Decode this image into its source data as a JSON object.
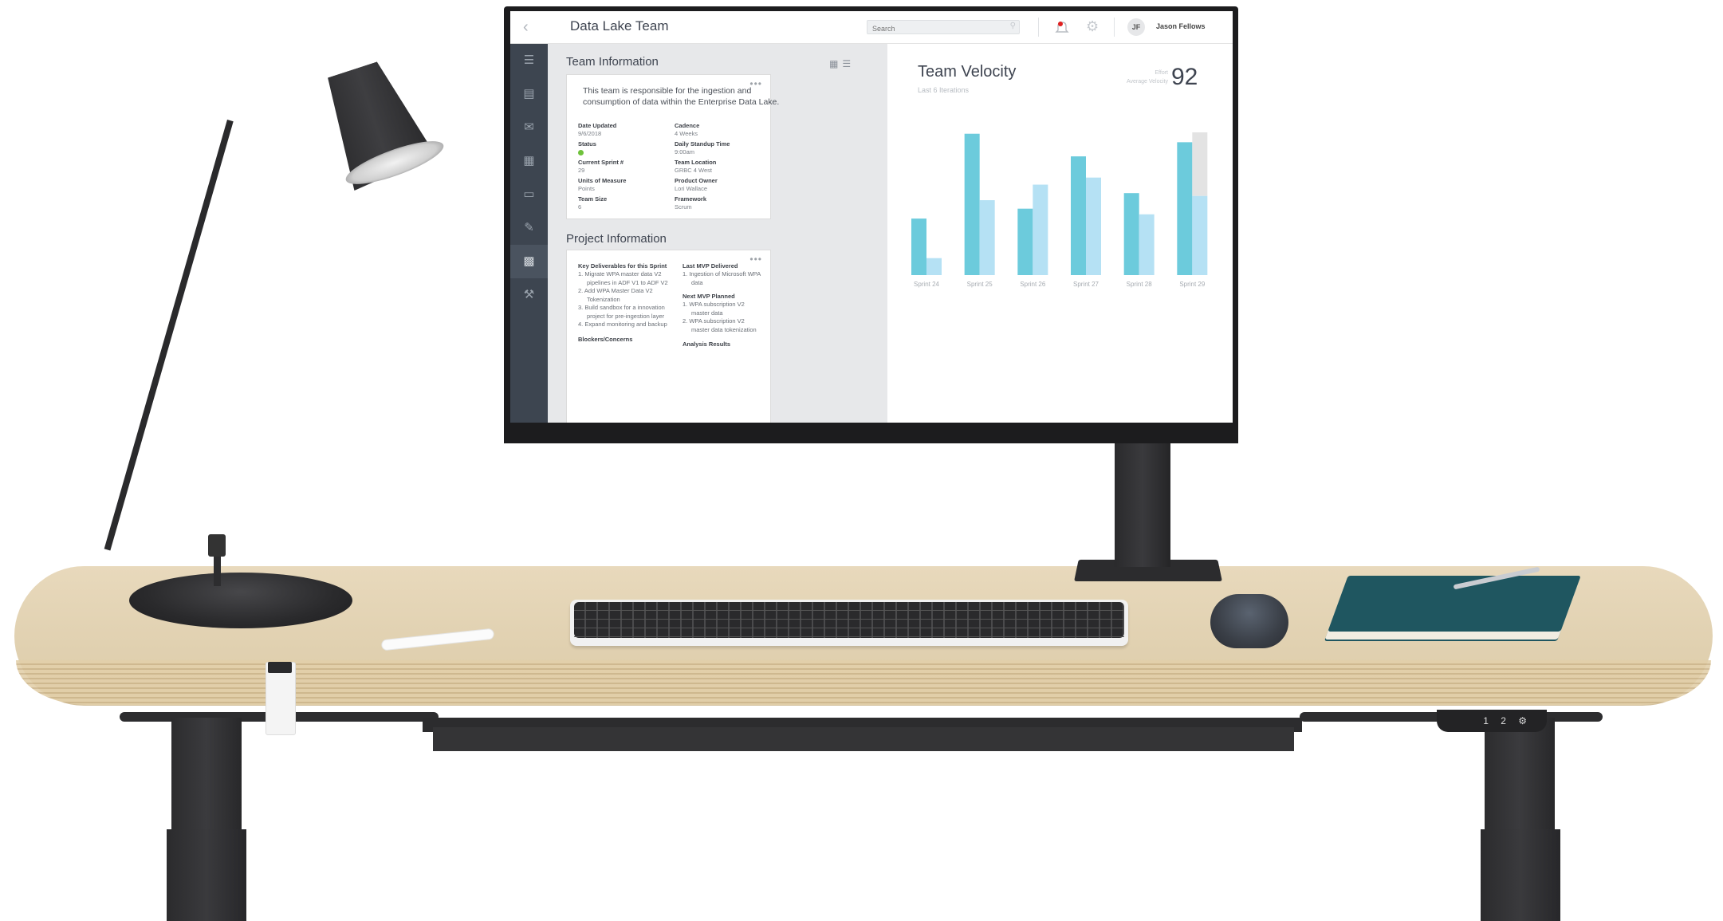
{
  "app": {
    "title": "Data Lake Team",
    "search_placeholder": "Search",
    "user_initials": "JF",
    "user_name": "Jason Fellows"
  },
  "team_info": {
    "title": "Team Information",
    "description": "This team is responsible for the ingestion and consumption of data within the Enterprise Data Lake.",
    "fields": {
      "date_updated": {
        "label": "Date Updated",
        "value": "9/6/2018"
      },
      "cadence": {
        "label": "Cadence",
        "value": "4 Weeks"
      },
      "status": {
        "label": "Status",
        "value": "",
        "color": "#6fc23b"
      },
      "standup": {
        "label": "Daily Standup Time",
        "value": "9:00am"
      },
      "sprint": {
        "label": "Current Sprint #",
        "value": "29"
      },
      "location": {
        "label": "Team Location",
        "value": "GRBC 4 West"
      },
      "units": {
        "label": "Units of Measure",
        "value": "Points"
      },
      "owner": {
        "label": "Product Owner",
        "value": "Lori Wallace"
      },
      "size": {
        "label": "Team Size",
        "value": "6"
      },
      "framework": {
        "label": "Framework",
        "value": "Scrum"
      }
    }
  },
  "project_info": {
    "title": "Project Information",
    "deliverables_label": "Key Deliverables for this Sprint",
    "deliverables": [
      "1.  Migrate WPA master data V2 pipelines in ADF V1 to ADF V2",
      "2.  Add WPA Master Data V2 Tokenization",
      "3.  Build sandbox for a innovation project for pre-ingestion layer",
      "4.  Expand monitoring and backup"
    ],
    "blockers_label": "Blockers/Concerns",
    "last_mvp_label": "Last MVP Delivered",
    "last_mvp": [
      "1.  Ingestion of Microsoft WPA data"
    ],
    "next_mvp_label": "Next MVP Planned",
    "next_mvp": [
      "1.  WPA subscription V2 master data",
      "2.  WPA subscription V2 master data tokenization"
    ],
    "analysis_label": "Analysis Results"
  },
  "velocity": {
    "title": "Team Velocity",
    "subtitle": "Last 6 Iterations",
    "effort_label": "Effort",
    "avg_label": "Average Velocity",
    "value": "92"
  },
  "colors": {
    "sidebar": "#3d4550",
    "bar_primary": "#6ccbdc",
    "bar_secondary": "#b5e1f4",
    "bar_grey": "#e3e3e3"
  },
  "chart_data": {
    "type": "bar",
    "categories": [
      "Sprint 24",
      "Sprint 25",
      "Sprint 26",
      "Sprint 27",
      "Sprint 28",
      "Sprint 29"
    ],
    "series": [
      {
        "values": [
          40,
          100,
          47,
          84,
          58,
          94
        ]
      },
      {
        "values": [
          12,
          53,
          64,
          69,
          43,
          56
        ]
      }
    ],
    "stacked_top": [
      0,
      0,
      0,
      0,
      0,
      45
    ],
    "ylim": [
      0,
      110
    ],
    "grid": false
  },
  "desk": {
    "controller_buttons": "1 2 ⚙"
  }
}
